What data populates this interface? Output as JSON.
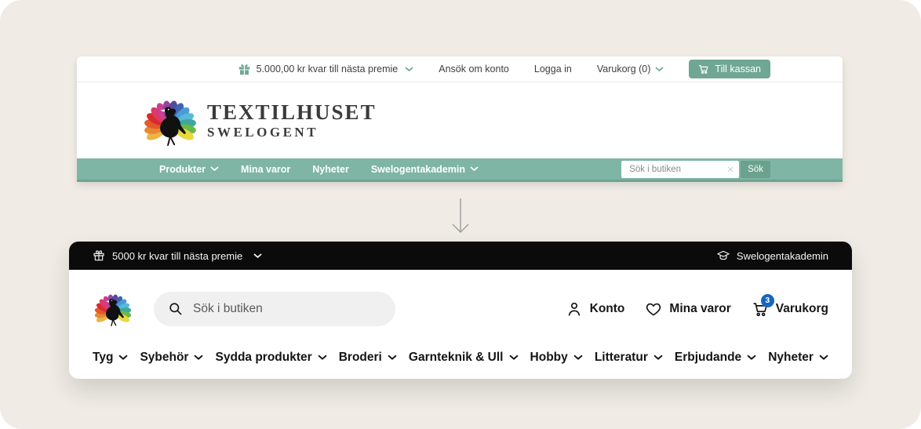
{
  "colors": {
    "background": "#f0ece5",
    "teal_bar": "#7eb5a5",
    "teal_dark": "#6da393",
    "button_green": "#6fa794",
    "badge_blue": "#1566c0",
    "black_bar": "#0b0b0b"
  },
  "icons": {
    "gift": "gift-icon",
    "cart": "cart-icon",
    "search": "search-icon",
    "user": "user-icon",
    "heart": "heart-icon",
    "graduation_cap": "graduation-cap-icon",
    "chevron_down": "chevron-down-icon",
    "close": "close-icon",
    "down_arrow": "down-arrow-icon",
    "logo": "peacock-logo"
  },
  "old_header": {
    "topbar": {
      "premie_text": "5.000,00 kr kvar till nästa premie",
      "apply_account": "Ansök om konto",
      "login": "Logga in",
      "cart": "Varukorg (0)",
      "checkout": "Till kassan"
    },
    "logo": {
      "line1": "TEXTILHUSET",
      "line2": "SWELOGENT"
    },
    "nav": {
      "items": [
        {
          "label": "Produkter",
          "has_dropdown": true
        },
        {
          "label": "Mina varor",
          "has_dropdown": false
        },
        {
          "label": "Nyheter",
          "has_dropdown": false
        },
        {
          "label": "Swelogentakademin",
          "has_dropdown": true
        }
      ],
      "search_placeholder": "Sök i butiken",
      "search_clear_glyph": "×",
      "search_button": "Sök"
    }
  },
  "new_header": {
    "topbar": {
      "premie_text": "5000 kr kvar till nästa premie",
      "academy": "Swelogentakademin"
    },
    "search_placeholder": "Sök i butiken",
    "account": "Konto",
    "wishlist": "Mina varor",
    "cart": "Varukorg",
    "cart_badge": "3",
    "nav_items": [
      "Tyg",
      "Sybehör",
      "Sydda produkter",
      "Broderi",
      "Garnteknik & Ull",
      "Hobby",
      "Litteratur",
      "Erbjudande",
      "Nyheter"
    ]
  }
}
